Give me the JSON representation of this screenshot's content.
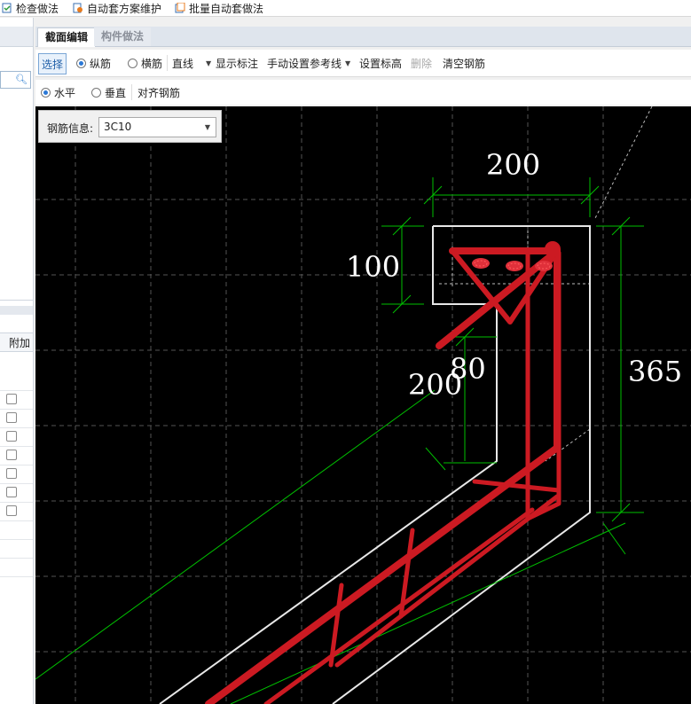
{
  "top_toolbar": {
    "items": [
      {
        "label": "检查做法",
        "icon": "check-document-icon"
      },
      {
        "label": "自动套方案维护",
        "icon": "auto-settings-icon"
      },
      {
        "label": "批量自动套做法",
        "icon": "batch-apply-icon"
      }
    ]
  },
  "left_panel": {
    "search_icon": "search-icon",
    "column_header": "附加",
    "checkbox_rows": 8
  },
  "tabs": [
    {
      "label": "截面编辑",
      "active": true
    },
    {
      "label": "构件做法",
      "active": false
    }
  ],
  "toolbar1": {
    "select": "选择",
    "longitudinal": "纵筋",
    "transverse": "横筋",
    "line_mode": "直线",
    "show_annotation": "显示标注",
    "manual_refline": "手动设置参考线",
    "set_elevation": "设置标高",
    "delete": "删除",
    "clear_rebar": "清空钢筋"
  },
  "toolbar2": {
    "horizontal": "水平",
    "vertical": "垂直",
    "align_rebar": "对齐钢筋"
  },
  "rebar_info": {
    "label": "钢筋信息:",
    "value": "3C10"
  },
  "drawing": {
    "dims": {
      "top_width": "200",
      "left_height": "100",
      "bottom_width": "200",
      "step": "80",
      "right_height": "365"
    },
    "colors": {
      "background": "#000000",
      "outline": "#ffffff",
      "rebar": "#cc1a22",
      "dimension": "#00cc00",
      "grid": "#555555"
    }
  }
}
